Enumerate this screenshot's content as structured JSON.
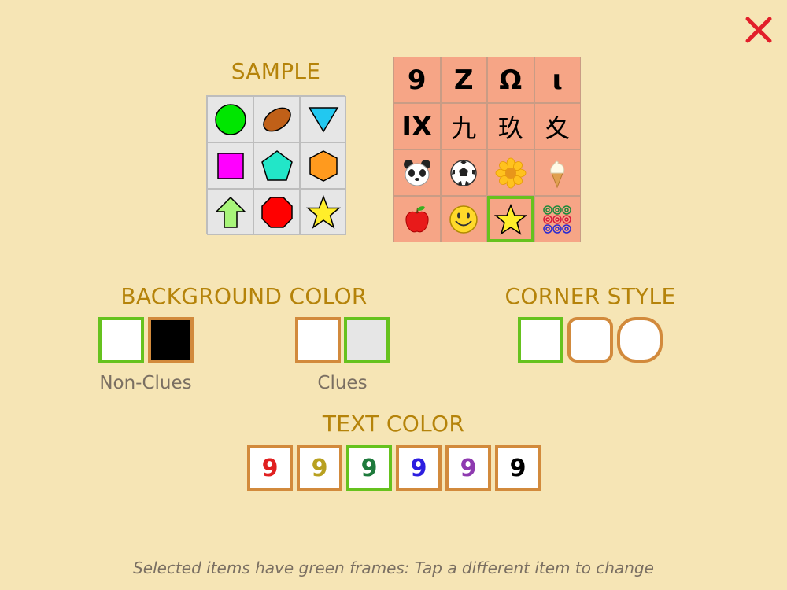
{
  "close_icon": "close-x-icon",
  "sample": {
    "title": "SAMPLE",
    "shapes": [
      "circle",
      "oval",
      "triangle-down",
      "square",
      "pentagon",
      "hexagon",
      "arrow-up",
      "octagon",
      "star"
    ],
    "colors": {
      "circle": "#00e600",
      "oval": "#c06018",
      "triangle": "#22c8f0",
      "square": "#ff00ff",
      "pentagon": "#22e6c8",
      "hexagon": "#ff9a1e",
      "arrow": "#a8f57a",
      "octagon": "#ff0000",
      "star": "#ffee2a"
    }
  },
  "symbols": {
    "rows": [
      [
        "9",
        "Z",
        "Ω",
        "ι"
      ],
      [
        "IX",
        "九",
        "玖",
        "夊"
      ],
      [
        "🐼",
        "⚽",
        "🌼",
        "🍦"
      ],
      [
        "🍎",
        "🙂",
        "★",
        "◎"
      ]
    ],
    "selected": "★"
  },
  "background_color": {
    "title": "BACKGROUND COLOR",
    "non_clues_label": "Non-Clues",
    "clues_label": "Clues",
    "non_clues_options": [
      {
        "color": "#ffffff",
        "selected": true
      },
      {
        "color": "#000000",
        "selected": false
      }
    ],
    "clues_options": [
      {
        "color": "#ffffff",
        "selected": false
      },
      {
        "color": "#e6e6e6",
        "selected": true
      }
    ]
  },
  "corner_style": {
    "title": "CORNER STYLE",
    "options": [
      {
        "style": "square",
        "selected": true
      },
      {
        "style": "rounded",
        "selected": false
      },
      {
        "style": "round",
        "selected": false
      }
    ]
  },
  "text_color": {
    "title": "TEXT COLOR",
    "glyph": "9",
    "options": [
      {
        "color": "#e02020",
        "selected": false
      },
      {
        "color": "#b8a020",
        "selected": false
      },
      {
        "color": "#1e7a3c",
        "selected": true
      },
      {
        "color": "#2c1ee0",
        "selected": false
      },
      {
        "color": "#8e3ab0",
        "selected": false
      },
      {
        "color": "#000000",
        "selected": false
      }
    ]
  },
  "footer_text": "Selected items have green frames: Tap a different item to change"
}
